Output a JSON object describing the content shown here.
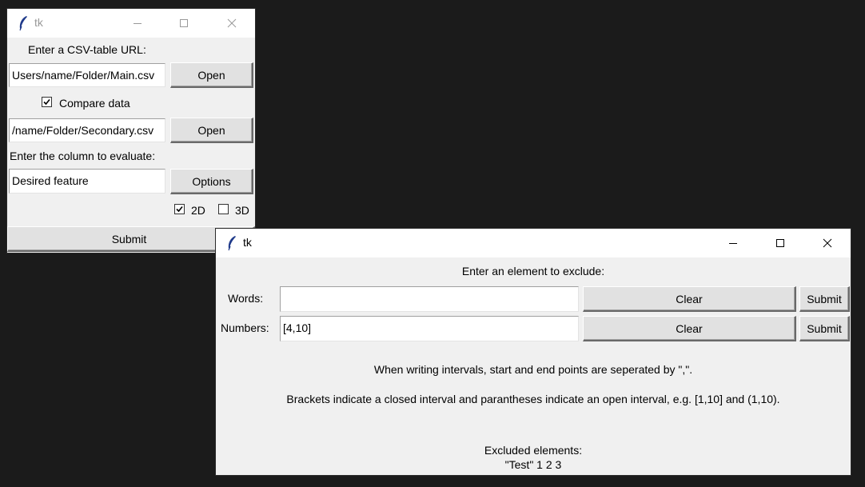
{
  "window1": {
    "title": "tk",
    "url_label": "Enter a CSV-table URL:",
    "main_path": "Users/name/Folder/Main.csv",
    "open_label": "Open",
    "compare_label": "Compare data",
    "compare_checked": true,
    "secondary_path": "/name/Folder/Secondary.csv",
    "open2_label": "Open",
    "column_label": "Enter the column to evaluate:",
    "column_value": "Desired feature",
    "options_label": "Options",
    "label_2d": "2D",
    "checked_2d": true,
    "label_3d": "3D",
    "checked_3d": false,
    "submit_label": "Submit"
  },
  "window2": {
    "title": "tk",
    "heading": "Enter an element to exclude:",
    "words_label": "Words:",
    "words_value": "",
    "numbers_label": "Numbers:",
    "numbers_value": "[4,10]",
    "clear_label": "Clear",
    "submit_label": "Submit",
    "info_line1": "When writing intervals, start and end points are seperated by \",\".",
    "info_line2": "Brackets indicate a closed interval and parantheses indicate an open interval, e.g. [1,10] and (1,10).",
    "excluded_heading": "Excluded elements:",
    "excluded_list": "\"Test\" 1 2 3"
  }
}
